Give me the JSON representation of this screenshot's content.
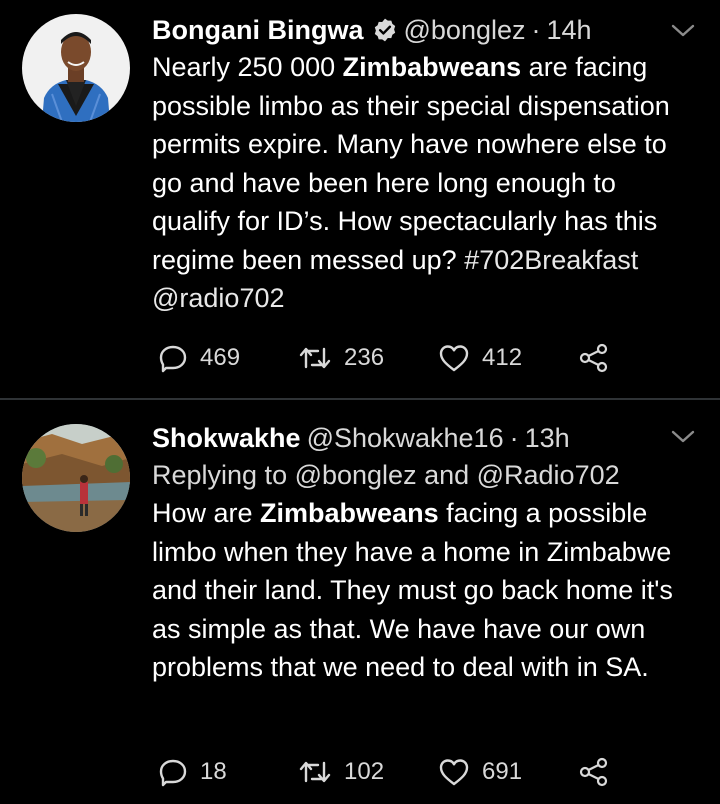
{
  "tweets": [
    {
      "display_name": "Bongani Bingwa",
      "verified": true,
      "handle": "@bonglez",
      "separator": "·",
      "time": "14h",
      "text_parts": [
        "Nearly 250 000 ",
        "Zimbabweans",
        " are facing possible limbo as their special dispensation permits expire. Many have nowhere else to go and have been here long enough to qualify for ID’s. How spectacularly has this regime been messed up? ",
        "#702Breakfast",
        " ",
        "@radio702"
      ],
      "replies": "469",
      "retweets": "236",
      "likes": "412"
    },
    {
      "display_name": "Shokwakhe",
      "verified": false,
      "handle": "@Shokwakhe16",
      "separator": "·",
      "time": "13h",
      "replying_to": "Replying to @bonglez and @Radio702",
      "text_parts": [
        "How are ",
        "Zimbabweans",
        " facing a possible limbo when they have a home in Zimbabwe and their land. They must go back home it's as simple as that.  We have have our own problems that we need to deal with in SA."
      ],
      "replies": "18",
      "retweets": "102",
      "likes": "691"
    }
  ],
  "colors": {
    "background": "#000000",
    "text": "#ffffff",
    "secondary": "#d9d9d9",
    "divider": "#2f3336"
  },
  "icons": [
    "verified-badge-icon",
    "chevron-down-icon",
    "reply-icon",
    "retweet-icon",
    "like-icon",
    "share-icon"
  ]
}
